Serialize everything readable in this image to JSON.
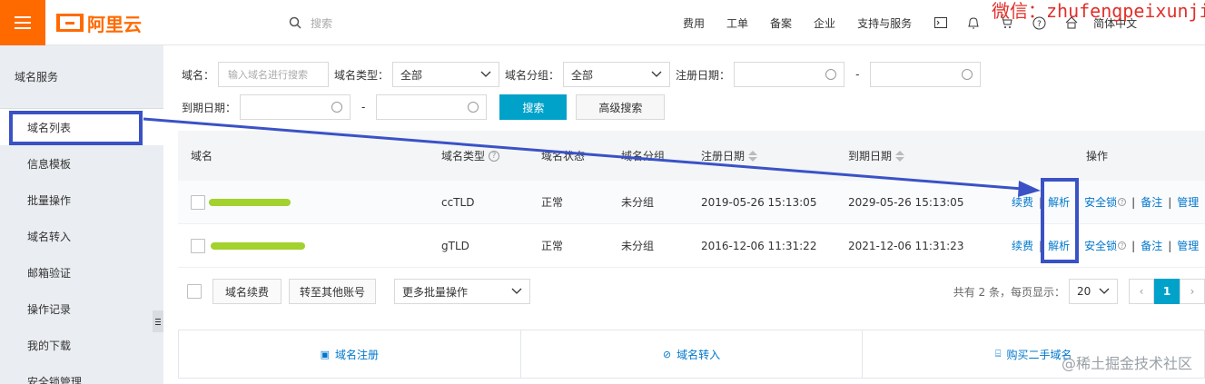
{
  "topbar": {
    "logo_text": "阿里云",
    "search_placeholder": "搜索",
    "nav": [
      "费用",
      "工单",
      "备案",
      "企业",
      "支持与服务"
    ],
    "icons": [
      "terminal-icon",
      "bell-icon",
      "cart-icon",
      "help-icon",
      "home-icon"
    ],
    "lang": "简体中文",
    "watermark": "微信：zhufengpeixunjiu"
  },
  "sidebar": {
    "header": "域名服务",
    "items": [
      "域名列表",
      "信息模板",
      "批量操作",
      "域名转入",
      "邮箱验证",
      "操作记录",
      "我的下载",
      "安全锁管理"
    ]
  },
  "filters": {
    "domain_label": "域名：",
    "domain_placeholder": "输入域名进行搜索",
    "type_label": "域名类型：",
    "type_value": "全部",
    "group_label": "域名分组：",
    "group_value": "全部",
    "reg_label": "注册日期：",
    "exp_label": "到期日期：",
    "dash": "-",
    "search_button": "搜索",
    "advanced_button": "高级搜索"
  },
  "table": {
    "headers": {
      "domain": "域名",
      "type": "域名类型",
      "status": "域名状态",
      "group": "域名分组",
      "reg_date": "注册日期",
      "exp_date": "到期日期",
      "ops": "操作"
    },
    "rows": [
      {
        "type": "ccTLD",
        "status": "正常",
        "group": "未分组",
        "reg_date": "2019-05-26 15:13:05",
        "exp_date": "2029-05-26 15:13:05"
      },
      {
        "type": "gTLD",
        "status": "正常",
        "group": "未分组",
        "reg_date": "2016-12-06 11:31:22",
        "exp_date": "2021-12-06 11:31:23"
      }
    ],
    "ops": {
      "renew": "续费",
      "resolve": "解析",
      "lock": "安全锁",
      "note": "备注",
      "manage": "管理",
      "sep": "|"
    }
  },
  "footer": {
    "renew_button": "域名续费",
    "transfer_button": "转至其他账号",
    "batch_select": "更多批量操作",
    "summary": "共有 2 条，每页显示：",
    "page_size": "20",
    "current_page": "1"
  },
  "bottom_actions": [
    {
      "label": "域名注册",
      "icon": "register-icon"
    },
    {
      "label": "域名转入",
      "icon": "transfer-icon"
    },
    {
      "label": "购买二手域名",
      "icon": "cart-icon"
    }
  ],
  "watermark_bottom": "@稀土掘金技术社区",
  "colors": {
    "brand": "#ff6a00",
    "primary": "#00a2ca",
    "link": "#0077cc",
    "annotation": "#3a52c6",
    "blur_mark": "#a3d12e"
  }
}
